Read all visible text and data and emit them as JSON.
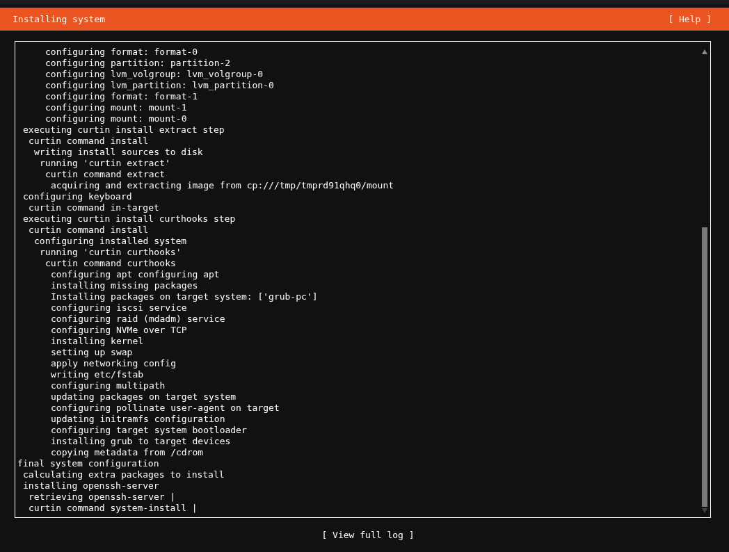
{
  "header": {
    "title": "Installing system",
    "help": "[ Help ]"
  },
  "log": {
    "lines": [
      {
        "children": [
          {
            "children": [
              {
                "children": [
                  {
                    "children": [
                      {
                        "children": [
                          {
                            "text": "configuring format: format-0"
                          },
                          {
                            "text": "configuring partition: partition-2"
                          },
                          {
                            "text": "configuring lvm_volgroup: lvm_volgroup-0"
                          },
                          {
                            "text": "configuring lvm_partition: lvm_partition-0"
                          },
                          {
                            "text": "configuring format: format-1"
                          },
                          {
                            "text": "configuring mount: mount-1"
                          },
                          {
                            "text": "configuring mount: mount-0"
                          }
                        ]
                      }
                    ]
                  }
                ]
              }
            ]
          },
          {
            "text": "executing curtin install extract step",
            "children": [
              {
                "text": "curtin command install",
                "children": [
                  {
                    "text": "writing install sources to disk",
                    "children": [
                      {
                        "text": "running 'curtin extract'",
                        "children": [
                          {
                            "text": "curtin command extract",
                            "children": [
                              {
                                "text": "acquiring and extracting image from cp:///tmp/tmprd91qhq0/mount"
                              }
                            ]
                          }
                        ]
                      }
                    ]
                  }
                ]
              }
            ]
          },
          {
            "text": "configuring keyboard",
            "children": [
              {
                "text": "curtin command in-target"
              }
            ]
          },
          {
            "text": "executing curtin install curthooks step",
            "children": [
              {
                "text": "curtin command install",
                "children": [
                  {
                    "text": "configuring installed system",
                    "children": [
                      {
                        "text": "running 'curtin curthooks'",
                        "children": [
                          {
                            "text": "curtin command curthooks",
                            "children": [
                              {
                                "text": "configuring apt configuring apt"
                              },
                              {
                                "text": "installing missing packages"
                              },
                              {
                                "text": "Installing packages on target system: ['grub-pc']"
                              },
                              {
                                "text": "configuring iscsi service"
                              },
                              {
                                "text": "configuring raid (mdadm) service"
                              },
                              {
                                "text": "configuring NVMe over TCP"
                              },
                              {
                                "text": "installing kernel"
                              },
                              {
                                "text": "setting up swap"
                              },
                              {
                                "text": "apply networking config"
                              },
                              {
                                "text": "writing etc/fstab"
                              },
                              {
                                "text": "configuring multipath"
                              },
                              {
                                "text": "updating packages on target system"
                              },
                              {
                                "text": "configuring pollinate user-agent on target"
                              },
                              {
                                "text": "updating initramfs configuration"
                              },
                              {
                                "text": "configuring target system bootloader"
                              },
                              {
                                "text": "installing grub to target devices"
                              },
                              {
                                "text": "copying metadata from /cdrom"
                              }
                            ]
                          }
                        ]
                      }
                    ]
                  }
                ]
              }
            ]
          }
        ]
      },
      {
        "text": "final system configuration",
        "children": [
          {
            "text": "calculating extra packages to install"
          },
          {
            "text": "installing openssh-server",
            "children": [
              {
                "text": "retrieving openssh-server |"
              },
              {
                "text": "curtin command system-install |"
              }
            ]
          }
        ]
      }
    ]
  },
  "footer": {
    "button": "[ View full log ]"
  }
}
